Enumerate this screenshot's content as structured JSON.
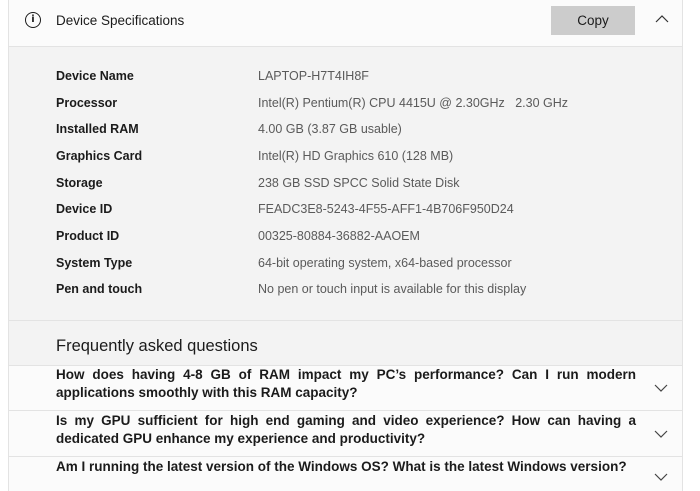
{
  "header": {
    "title": "Device Specifications",
    "copy_label": "Copy"
  },
  "specs": [
    {
      "label": "Device Name",
      "value": "LAPTOP-H7T4IH8F"
    },
    {
      "label": "Processor",
      "value": "Intel(R) Pentium(R) CPU 4415U @ 2.30GHz   2.30 GHz"
    },
    {
      "label": "Installed RAM",
      "value": "4.00 GB (3.87 GB usable)"
    },
    {
      "label": "Graphics Card",
      "value": "Intel(R) HD Graphics 610 (128 MB)"
    },
    {
      "label": "Storage",
      "value": "238 GB SSD SPCC Solid State Disk"
    },
    {
      "label": "Device ID",
      "value": "FEADC3E8-5243-4F55-AFF1-4B706F950D24"
    },
    {
      "label": "Product ID",
      "value": "00325-80884-36882-AAOEM"
    },
    {
      "label": "System Type",
      "value": "64-bit operating system, x64-based processor"
    },
    {
      "label": "Pen and touch",
      "value": "No pen or touch input is available for this display"
    }
  ],
  "faq": {
    "title": "Frequently asked questions",
    "items": [
      {
        "question": "How does having 4-8 GB of RAM impact my PC’s performance? Can I run modern applications smoothly with this RAM capacity?"
      },
      {
        "question": "Is my GPU sufficient for high end gaming and video experience? How can having a dedicated GPU enhance my experience and productivity?"
      },
      {
        "question": "Am I running the latest version of the Windows OS? What is the latest Windows version?"
      }
    ]
  }
}
